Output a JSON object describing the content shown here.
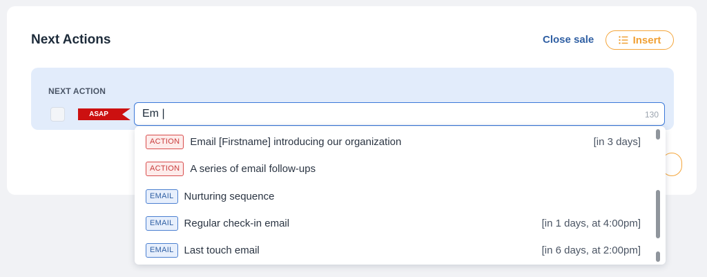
{
  "card": {
    "title": "Next Actions",
    "close_sale_label": "Close sale",
    "insert_label": "Insert",
    "insert_icon": "list-icon"
  },
  "next_action": {
    "label": "NEXT ACTION",
    "priority_flag": "ASAP",
    "input_value": "Em |",
    "char_count": "130"
  },
  "colors": {
    "accent_blue": "#3a78d8",
    "accent_orange": "#f0a034",
    "flag_red": "#cc1010"
  },
  "suggestions": [
    {
      "type": "ACTION",
      "text": "Email [Firstname] introducing our organization",
      "when": "[in 3 days]"
    },
    {
      "type": "ACTION",
      "text": "A series of email follow-ups",
      "when": ""
    },
    {
      "type": "EMAIL",
      "text": "Nurturing sequence",
      "when": ""
    },
    {
      "type": "EMAIL",
      "text": "Regular check-in email",
      "when": "[in 1 days, at 4:00pm]"
    },
    {
      "type": "EMAIL",
      "text": "Last touch email",
      "when": "[in 6 days, at 2:00pm]"
    }
  ]
}
